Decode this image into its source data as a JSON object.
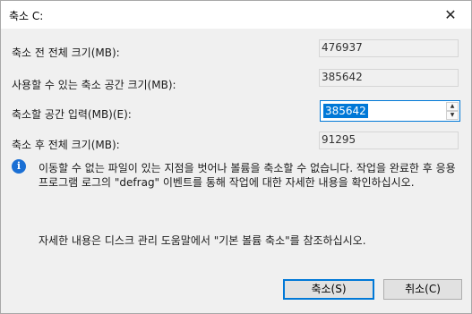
{
  "window": {
    "title": "축소 C:"
  },
  "labels": {
    "total_before": "축소 전 전체 크기(MB):",
    "available": "사용할 수 있는 축소 공간 크기(MB):",
    "shrink_input": "축소할 공간 입력(MB)(E):",
    "total_after": "축소 후 전체 크기(MB):"
  },
  "values": {
    "total_before": "476937",
    "available": "385642",
    "shrink_input": "385642",
    "total_after": "91295"
  },
  "info": {
    "message": "이동할 수 없는 파일이 있는 지점을 벗어나 볼륨을 축소할 수 없습니다. 작업을 완료한 후 응용 프로그램 로그의 \"defrag\" 이벤트를 통해 작업에 대한 자세한 내용을 확인하십시오.",
    "help": "자세한 내용은 디스크 관리 도움말에서 \"기본 볼륨 축소\"를 참조하십시오."
  },
  "buttons": {
    "shrink": "축소(S)",
    "cancel": "취소(C)"
  },
  "icons": {
    "info": "info-icon",
    "close": "close-icon"
  },
  "colors": {
    "accent": "#0078d7",
    "info_icon": "#1a6fd4"
  }
}
